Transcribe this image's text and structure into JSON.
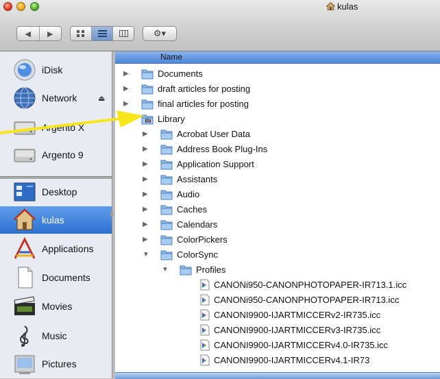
{
  "window": {
    "title": "kulas"
  },
  "toolbar": {
    "back_glyph": "◀",
    "forward_glyph": "▶",
    "view_icons": [
      "icon-view-icon",
      "list-view-icon",
      "column-view-icon"
    ],
    "action_glyph": "⚙▾"
  },
  "sidebar": {
    "items": [
      {
        "label": "iDisk",
        "icon": "idisk-icon"
      },
      {
        "label": "Network",
        "icon": "network-globe-icon",
        "eject": "⏏"
      },
      {
        "label": "Argento X",
        "icon": "hard-drive-icon"
      },
      {
        "label": "Argento 9",
        "icon": "hard-drive-icon"
      },
      {
        "label": "Desktop",
        "icon": "desktop-icon"
      },
      {
        "label": "kulas",
        "icon": "home-icon",
        "selected": true
      },
      {
        "label": "Applications",
        "icon": "applications-icon"
      },
      {
        "label": "Documents",
        "icon": "documents-icon"
      },
      {
        "label": "Movies",
        "icon": "movies-icon"
      },
      {
        "label": "Music",
        "icon": "music-icon"
      },
      {
        "label": "Pictures",
        "icon": "pictures-icon"
      }
    ]
  },
  "list": {
    "column_header": "Name",
    "rows": [
      {
        "label": "Documents",
        "type": "folder",
        "expanded": false
      },
      {
        "label": "draft articles for posting",
        "type": "folder",
        "expanded": false
      },
      {
        "label": "final articles for posting",
        "type": "folder",
        "expanded": false
      },
      {
        "label": "Library",
        "type": "folder",
        "expanded": true
      },
      {
        "label": "Acrobat User Data",
        "type": "folder",
        "expanded": false
      },
      {
        "label": "Address Book Plug-Ins",
        "type": "folder",
        "expanded": false
      },
      {
        "label": "Application Support",
        "type": "folder",
        "expanded": false
      },
      {
        "label": "Assistants",
        "type": "folder",
        "expanded": false
      },
      {
        "label": "Audio",
        "type": "folder",
        "expanded": false
      },
      {
        "label": "Caches",
        "type": "folder",
        "expanded": false
      },
      {
        "label": "Calendars",
        "type": "folder",
        "expanded": false
      },
      {
        "label": "ColorPickers",
        "type": "folder",
        "expanded": false
      },
      {
        "label": "ColorSync",
        "type": "folder",
        "expanded": true
      },
      {
        "label": "Profiles",
        "type": "folder",
        "expanded": true
      },
      {
        "label": "CANONi950-CANONPHOTOPAPER-IR713.1.icc",
        "type": "file"
      },
      {
        "label": "CANONi950-CANONPHOTOPAPER-IR713.icc",
        "type": "file"
      },
      {
        "label": "CANONI9900-IJARTMICCERv2-IR735.icc",
        "type": "file"
      },
      {
        "label": "CANONI9900-IJARTMICCERv3-IR735.icc",
        "type": "file"
      },
      {
        "label": "CANONI9900-IJARTMICCERv4.0-IR735.icc",
        "type": "file"
      },
      {
        "label": "CANONI9900-IJARTMICCERv4.1-IR73",
        "type": "file"
      }
    ]
  },
  "colors": {
    "selection": "#2d6fd2",
    "folder": "#8fbce9",
    "annotation_arrow": "#f7e51b"
  }
}
